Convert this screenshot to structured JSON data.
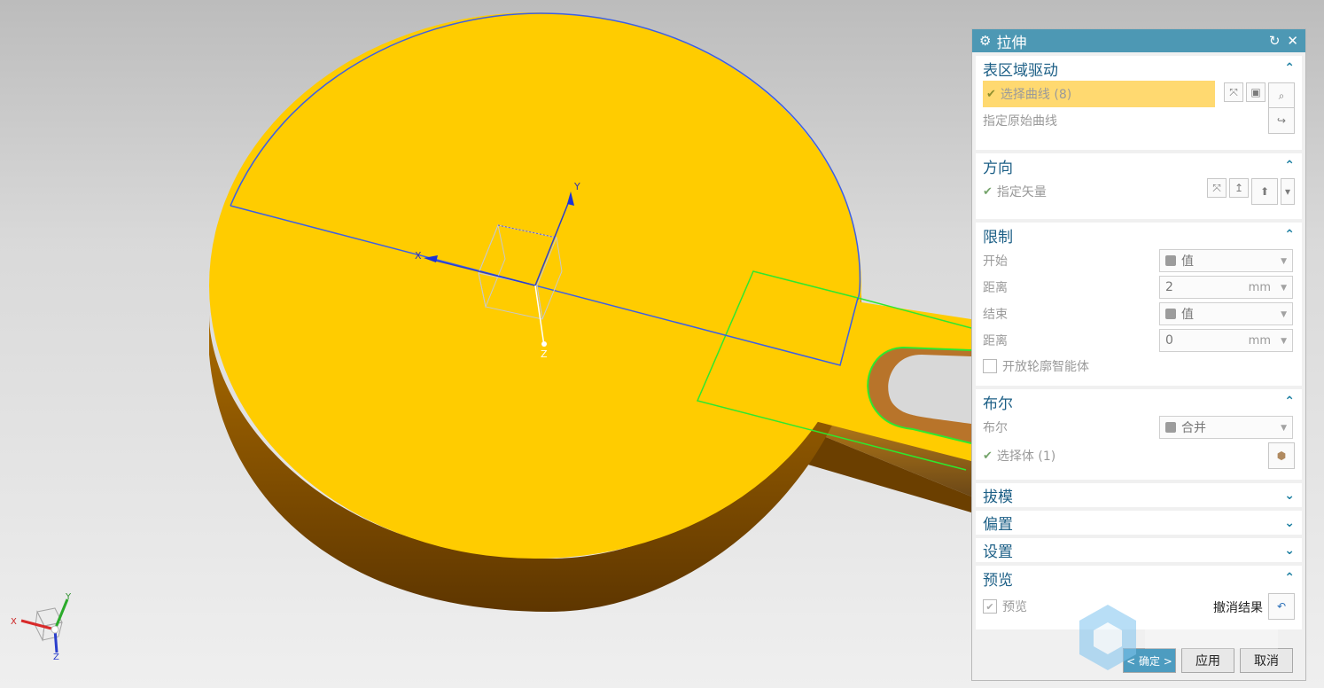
{
  "panel": {
    "title": "拉伸",
    "sections": {
      "curves": {
        "label": "表区域驱动",
        "select_curve": "选择曲线 (8)",
        "origin_curve": "指定原始曲线"
      },
      "direction": {
        "label": "方向",
        "vector": "指定矢量"
      },
      "limits": {
        "label": "限制",
        "start_label": "开始",
        "start_value": "值",
        "distance1_label": "距离",
        "distance1_value": "2",
        "distance1_unit": "mm",
        "end_label": "结束",
        "end_value": "值",
        "distance2_label": "距离",
        "distance2_value": "0",
        "distance2_unit": "mm",
        "open_profile": "开放轮廓智能体"
      },
      "boolean": {
        "label": "布尔",
        "bool_label": "布尔",
        "bool_value": "合并",
        "select_body": "选择体 (1)"
      },
      "draft": {
        "label": "拔模"
      },
      "offset": {
        "label": "偏置"
      },
      "settings": {
        "label": "设置"
      },
      "preview": {
        "label": "预览",
        "preview_label": "预览",
        "undo_label": "撤消结果"
      }
    },
    "footer": {
      "ok": "< 确定 >",
      "apply": "应用",
      "cancel": "取消"
    }
  },
  "viewport": {
    "axis_x": "X",
    "axis_y": "Y",
    "axis_z": "Z",
    "triad_x": "X",
    "triad_y": "Y",
    "triad_z": "Z"
  },
  "colors": {
    "face": "#ffcc00",
    "side": "#7a4a00",
    "edge_blue": "#3c5fe6",
    "edge_green": "#2ee82e",
    "title_bar": "#4d98b4",
    "highlight": "#ffd970"
  }
}
